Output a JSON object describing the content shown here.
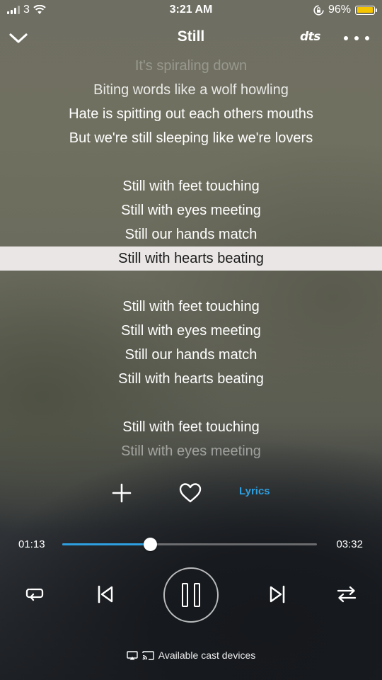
{
  "status_bar": {
    "carrier": "3",
    "time": "3:21 AM",
    "battery_percent": "96%",
    "battery_level": 0.96,
    "icons": [
      "signal-icon",
      "wifi-icon",
      "orientation-lock-icon",
      "battery-icon"
    ]
  },
  "header": {
    "title": "Still",
    "dts_label": "dts",
    "icons": [
      "chevron-down-icon",
      "more-icon"
    ]
  },
  "lyrics": {
    "lines": [
      "It's spiraling down",
      "Biting words like a wolf howling",
      "Hate is spitting out each others mouths",
      "But we're still sleeping like we're lovers",
      "",
      "Still with feet touching",
      "Still with eyes meeting",
      "Still our hands match",
      "Still with hearts beating",
      "",
      "Still with feet touching",
      "Still with eyes meeting",
      "Still our hands match",
      "Still with hearts beating",
      "",
      "Still with feet touching",
      "Still with eyes meeting"
    ],
    "active_index": 8
  },
  "actions": {
    "lyrics_label": "Lyrics",
    "icons": [
      "plus-icon",
      "heart-icon"
    ]
  },
  "playback": {
    "elapsed": "01:13",
    "total": "03:32",
    "progress_fraction": 0.345
  },
  "controls": {
    "icons": [
      "repeat-icon",
      "previous-icon",
      "pause-icon",
      "next-icon",
      "shuffle-icon"
    ]
  },
  "cast": {
    "label": "Available cast devices",
    "icons": [
      "airplay-icon",
      "cast-icon"
    ]
  },
  "colors": {
    "accent": "#2e9fe0",
    "active_line_bg": "#e9e6e5",
    "battery": "#f5c400"
  }
}
